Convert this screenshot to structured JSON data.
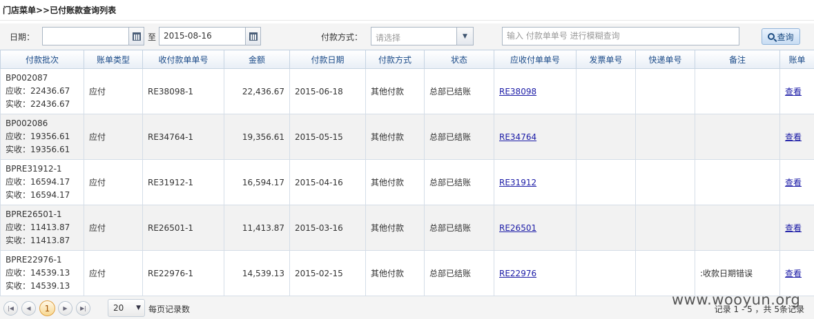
{
  "breadcrumb": "门店菜单>>已付账款查询列表",
  "filters": {
    "date_label": "日期：",
    "date_from": "",
    "to_label": "至",
    "date_to": "2015-08-16",
    "pay_method_label": "付款方式：",
    "pay_method_placeholder": "请选择",
    "search_placeholder": "输入 付款单单号 进行模糊查询",
    "search_button": "查询"
  },
  "table": {
    "headers": [
      "付款批次",
      "账单类型",
      "收付款单单号",
      "金额",
      "付款日期",
      "付款方式",
      "状态",
      "应收付单单号",
      "发票单号",
      "快递单号",
      "备注",
      "账单"
    ],
    "rows": [
      {
        "batch": "BP002087",
        "receivable": "应收：22436.67",
        "received": "实收：22436.67",
        "type": "应付",
        "doc_no": "RE38098-1",
        "amount": "22,436.67",
        "date": "2015-06-18",
        "method": "其他付款",
        "status": "总部已结账",
        "ref_no": "RE38098",
        "invoice": "",
        "express": "",
        "remark": "",
        "action": "查看"
      },
      {
        "batch": "BP002086",
        "receivable": "应收：19356.61",
        "received": "实收：19356.61",
        "type": "应付",
        "doc_no": "RE34764-1",
        "amount": "19,356.61",
        "date": "2015-05-15",
        "method": "其他付款",
        "status": "总部已结账",
        "ref_no": "RE34764",
        "invoice": "",
        "express": "",
        "remark": "",
        "action": "查看"
      },
      {
        "batch": "BPRE31912-1",
        "receivable": "应收：16594.17",
        "received": "实收：16594.17",
        "type": "应付",
        "doc_no": "RE31912-1",
        "amount": "16,594.17",
        "date": "2015-04-16",
        "method": "其他付款",
        "status": "总部已结账",
        "ref_no": "RE31912",
        "invoice": "",
        "express": "",
        "remark": "",
        "action": "查看"
      },
      {
        "batch": "BPRE26501-1",
        "receivable": "应收：11413.87",
        "received": "实收：11413.87",
        "type": "应付",
        "doc_no": "RE26501-1",
        "amount": "11,413.87",
        "date": "2015-03-16",
        "method": "其他付款",
        "status": "总部已结账",
        "ref_no": "RE26501",
        "invoice": "",
        "express": "",
        "remark": "",
        "action": "查看"
      },
      {
        "batch": "BPRE22976-1",
        "receivable": "应收：14539.13",
        "received": "实收：14539.13",
        "type": "应付",
        "doc_no": "RE22976-1",
        "amount": "14,539.13",
        "date": "2015-02-15",
        "method": "其他付款",
        "status": "总部已结账",
        "ref_no": "RE22976",
        "invoice": "",
        "express": "",
        "remark": ":收款日期错误",
        "action": "查看"
      }
    ]
  },
  "pager": {
    "current_page": "1",
    "page_size": "20",
    "per_page_label": "每页记录数",
    "records_text": "记录 1 - 5 ，共 5条记录"
  },
  "watermark": "www.wooyun.org",
  "icons": {
    "first": "first-page-icon",
    "prev": "prev-page-icon",
    "next": "next-page-icon",
    "last": "last-page-icon",
    "calendar": "calendar-icon",
    "search": "magnifier-icon"
  }
}
